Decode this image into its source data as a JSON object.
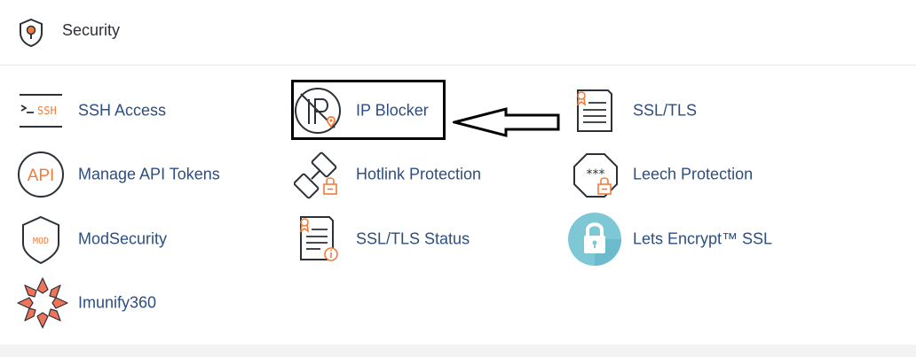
{
  "section": {
    "title": "Security",
    "icon": "shield-pin-icon"
  },
  "items": [
    {
      "id": "ssh-access",
      "label": "SSH Access",
      "icon": "terminal-ssh-icon"
    },
    {
      "id": "ip-blocker",
      "label": "IP Blocker",
      "icon": "ip-blocker-icon"
    },
    {
      "id": "ssl-tls",
      "label": "SSL/TLS",
      "icon": "certificate-icon"
    },
    {
      "id": "manage-api-tokens",
      "label": "Manage API Tokens",
      "icon": "api-icon"
    },
    {
      "id": "hotlink-protection",
      "label": "Hotlink Protection",
      "icon": "broken-link-lock-icon"
    },
    {
      "id": "leech-protection",
      "label": "Leech Protection",
      "icon": "octagon-password-lock-icon"
    },
    {
      "id": "modsecurity",
      "label": "ModSecurity",
      "icon": "mod-shield-icon"
    },
    {
      "id": "ssl-tls-status",
      "label": "SSL/TLS Status",
      "icon": "certificate-info-icon"
    },
    {
      "id": "lets-encrypt-ssl",
      "label": "Lets Encrypt™ SSL",
      "icon": "padlock-circle-icon"
    },
    {
      "id": "imunify360",
      "label": "Imunify360",
      "icon": "imunify-star-icon"
    }
  ],
  "colors": {
    "label": "#2d4e80",
    "accent_orange": "#f07c3b",
    "icon_dark": "#2b3137",
    "letsencrypt_teal": "#7ec8d6"
  },
  "annotation": {
    "highlighted_item": "IP Blocker",
    "arrow": "left-pointing arrow"
  }
}
